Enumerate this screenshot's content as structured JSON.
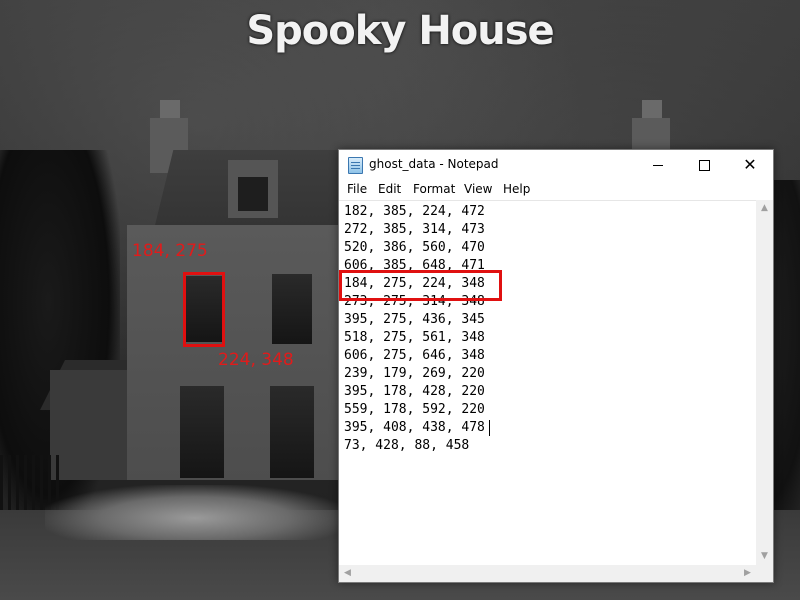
{
  "app": {
    "title": "Spooky House"
  },
  "annotation": {
    "top_left_label": "184, 275",
    "bottom_right_label": "224, 348",
    "color": "#e01010"
  },
  "notepad": {
    "window_title": "ghost_data - Notepad",
    "icon": "notepad-icon",
    "controls": {
      "minimize": "minimize-icon",
      "maximize": "maximize-icon",
      "close": "close-icon"
    },
    "menu": {
      "file": "File",
      "edit": "Edit",
      "format": "Format",
      "view": "View",
      "help": "Help"
    },
    "lines": [
      "182, 385, 224, 472",
      "272, 385, 314, 473",
      "520, 386, 560, 470",
      "606, 385, 648, 471",
      "184, 275, 224, 348",
      "273, 275, 314, 348",
      "395, 275, 436, 345",
      "518, 275, 561, 348",
      "606, 275, 646, 348",
      "239, 179, 269, 220",
      "395, 178, 428, 220",
      "559, 178, 592, 220",
      "395, 408, 438, 478",
      "73, 428, 88, 458"
    ],
    "highlighted_line_index": 4
  }
}
